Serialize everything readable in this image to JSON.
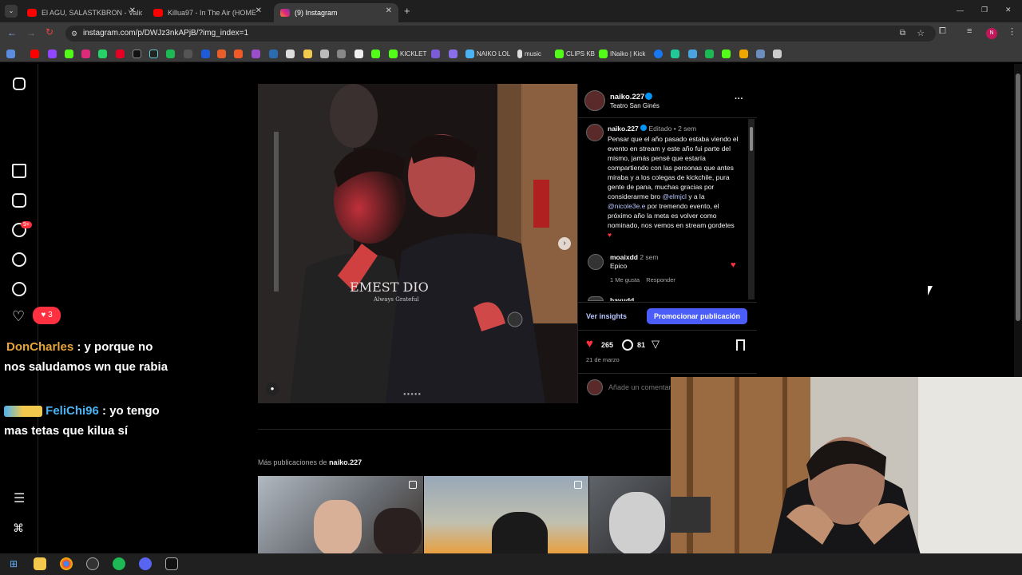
{
  "browser": {
    "tabs": [
      {
        "label": "El AGU, SALASTKBRON - Valio l",
        "icon": "youtube-icon"
      },
      {
        "label": "Killua97 - In The Air (HOME",
        "icon": "youtube-icon"
      },
      {
        "label": "(9) Instagram",
        "icon": "instagram-icon",
        "active": true
      }
    ],
    "new_tab": "+",
    "url": "instagram.com/p/DWJz3nkAPjB/?img_index=1",
    "window_controls": [
      "—",
      "❐",
      "✕"
    ],
    "bookmarks": [
      {
        "label": "KICKLET",
        "color": "#53fc18"
      },
      {
        "label": "NAIKO LOL",
        "color": "#4ab3f4"
      },
      {
        "label": "music",
        "color": "#dddddd"
      },
      {
        "label": "CLIPS KB",
        "color": "#53fc18"
      },
      {
        "label": "INaiko | Kick",
        "color": "#53fc18"
      }
    ]
  },
  "instagram_nav": {
    "notifications_badge": "9+",
    "likes_badge": "3"
  },
  "chat": [
    {
      "user": "DonCharles",
      "user_color": "#e8a33b",
      "message": " : y porque no nos saludamos wn que rabia"
    },
    {
      "user": "FeliChi96",
      "user_color": "#4ab3f4",
      "message": " : yo tengo mas tetas que kilua sí"
    }
  ],
  "post": {
    "username": "naiko.227",
    "location": "Teatro San Ginés",
    "more": "···",
    "caption_user": "naiko.227",
    "caption_edited": "Editado",
    "caption_time": "2 sem",
    "caption_text_1": "Pensar que el año pasado estaba viendo el evento en stream y este año fui parte del mismo, jamás pensé que estaría compartiendo con las personas que antes miraba y a los colegas de kickchile, pura gente de pana, muchas gracias por considerarme bro ",
    "mention_1": "@elmjcl",
    "caption_text_2": " y a la ",
    "mention_2": "@nicole3e.e",
    "caption_text_3": " por tremendo evento, el próximo año la meta es volver como nominado, nos vemos en stream gordetes",
    "comment_user": "moaixdd",
    "comment_time": "2 sem",
    "comment_text": "Epico",
    "comment_likes": "1 Me gusta",
    "comment_reply": "Responder",
    "next_comment_user": "bavudd",
    "insights": "Ver insights",
    "promote": "Promocionar publicación",
    "likes": "265",
    "comments": "81",
    "date": "21 de marzo",
    "add_comment": "Añade un comentario..."
  },
  "more_posts": {
    "label": "Más publicaciones de ",
    "user": "naiko.227"
  },
  "photo_text": {
    "shirt": "EMEST DIO",
    "shirt_sub": "Always Grateful"
  },
  "colors": {
    "instagram_blue": "#4a5df9",
    "like_red": "#ff3040",
    "bg": "#000000"
  }
}
